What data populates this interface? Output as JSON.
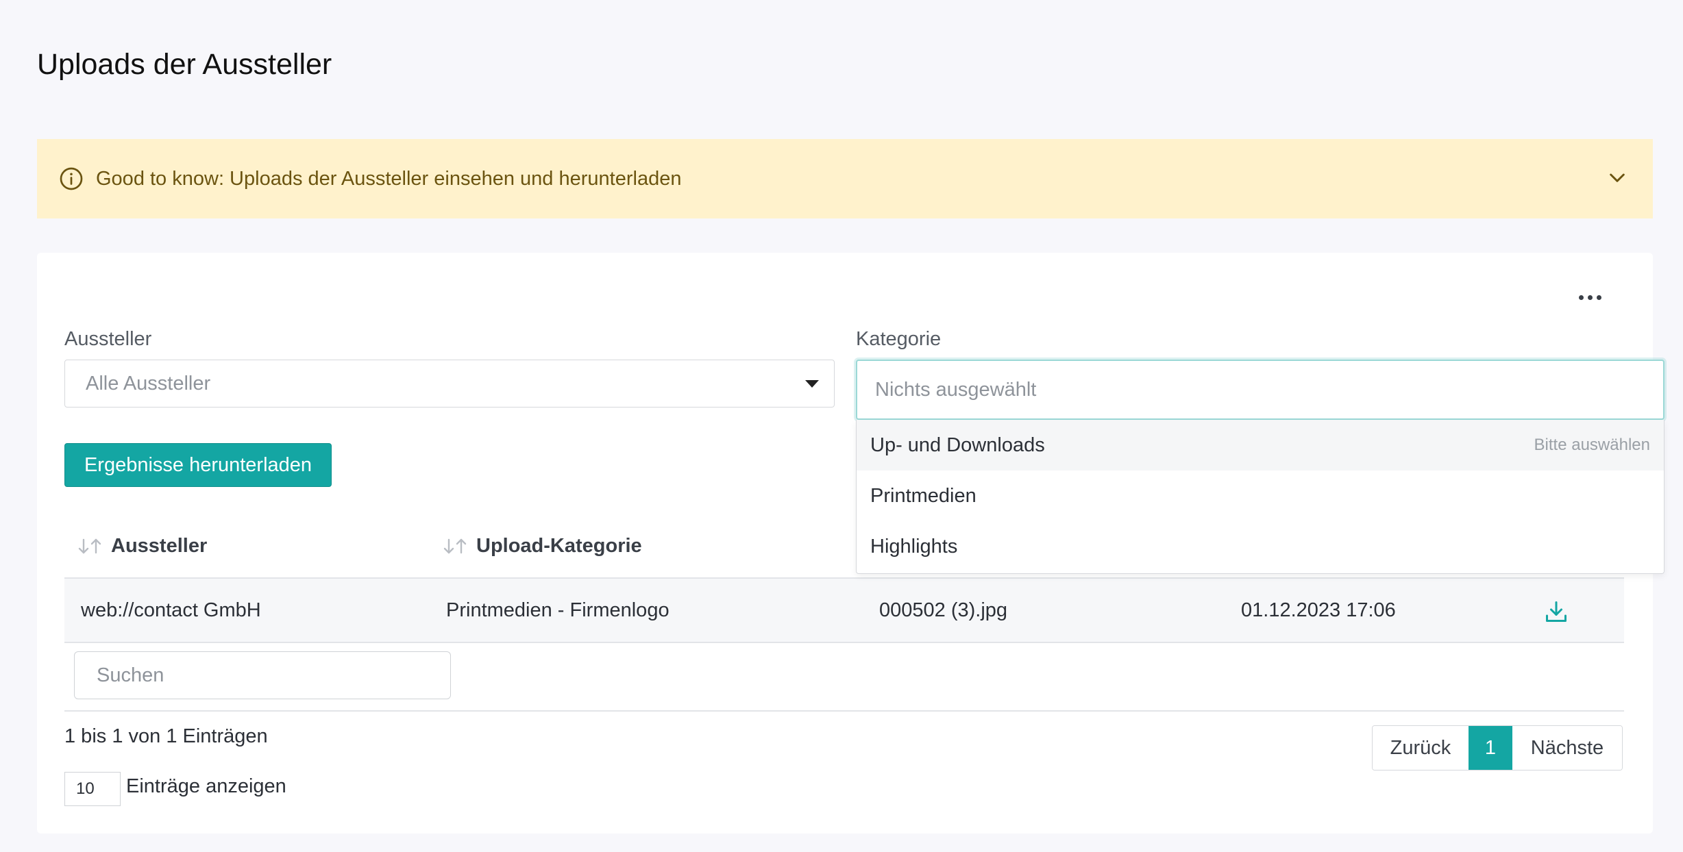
{
  "page": {
    "title": "Uploads der Aussteller"
  },
  "banner": {
    "text": "Good to know: Uploads der Aussteller einsehen und herunterladen"
  },
  "filters": {
    "exhibitor_label": "Aussteller",
    "exhibitor_placeholder": "Alle Aussteller",
    "category_label": "Kategorie",
    "category_placeholder": "Nichts ausgewählt",
    "category_group_hint": "Bitte auswählen",
    "category_options": [
      "Up- und Downloads",
      "Printmedien",
      "Highlights"
    ]
  },
  "actions": {
    "download_results": "Ergebnisse herunterladen"
  },
  "table": {
    "headers": [
      "Aussteller",
      "Upload-Kategorie"
    ],
    "rows": [
      {
        "exhibitor": "web://contact GmbH",
        "category": "Printmedien - Firmenlogo",
        "file": "000502 (3).jpg",
        "date": "01.12.2023 17:06"
      }
    ],
    "search_placeholder": "Suchen"
  },
  "footer": {
    "info": "1 bis 1 von 1 Einträgen",
    "page_length": "10",
    "page_length_label": "Einträge anzeigen",
    "prev": "Zurück",
    "current_page": "1",
    "next": "Nächste"
  },
  "colors": {
    "accent": "#14a6a3",
    "banner_bg": "#fff2cc",
    "banner_text": "#6b5410"
  }
}
